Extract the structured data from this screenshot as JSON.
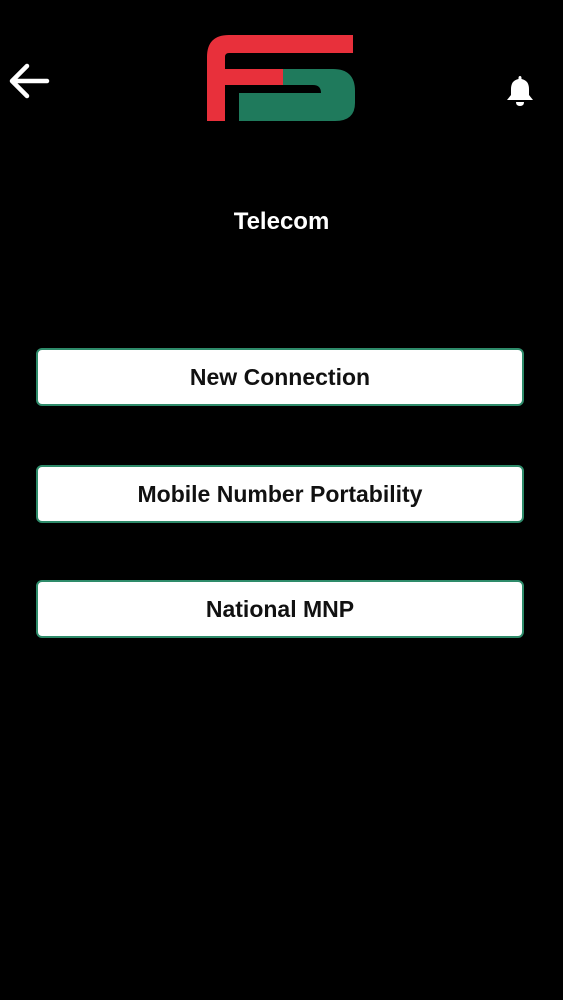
{
  "header": {
    "back_icon": "arrow-left-icon",
    "logo_text": "FS",
    "notification_icon": "bell-icon",
    "colors": {
      "logo_red": "#e8303b",
      "logo_green": "#1f7a5c"
    }
  },
  "page": {
    "title": "Telecom"
  },
  "menu": {
    "items": [
      {
        "label": "New Connection"
      },
      {
        "label": "Mobile Number Portability"
      },
      {
        "label": "National MNP"
      }
    ],
    "border_color": "#2e8b6a"
  }
}
